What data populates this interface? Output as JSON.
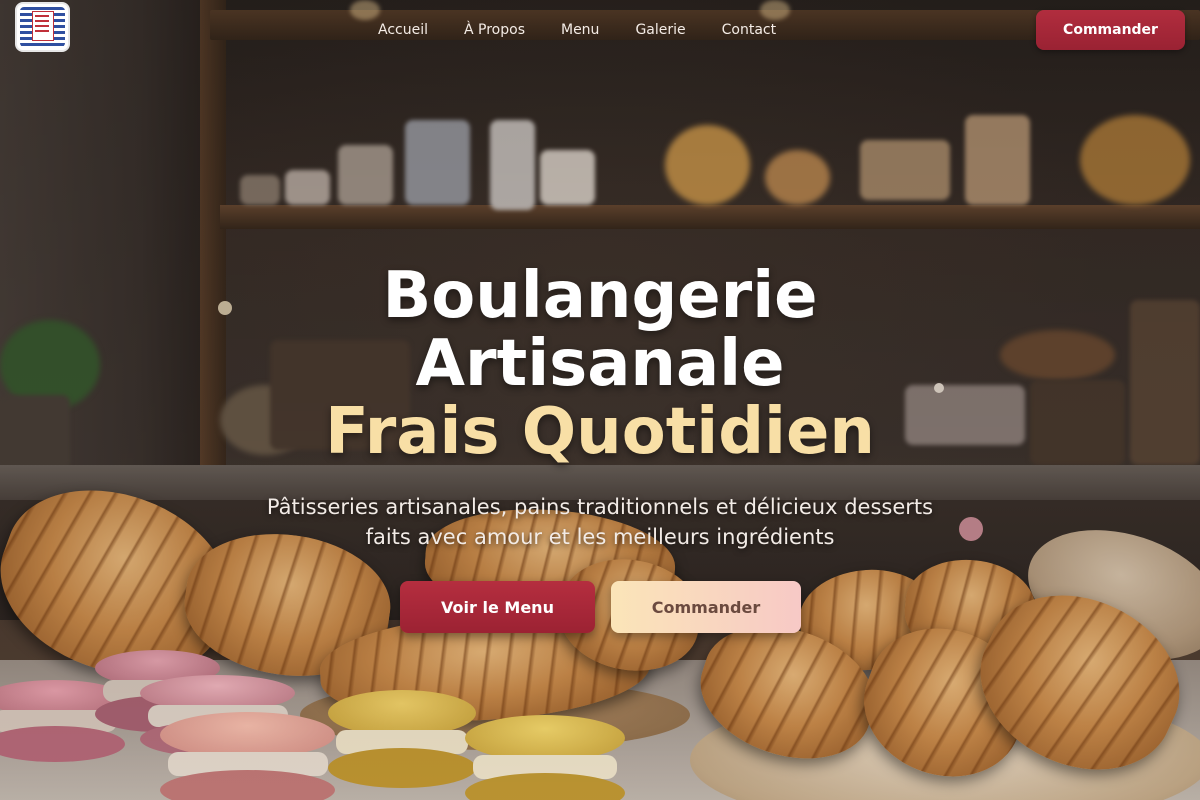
{
  "brand": {
    "logo_icon": "bakery-logo-icon"
  },
  "nav": {
    "items": [
      {
        "label": "Accueil"
      },
      {
        "label": "À Propos"
      },
      {
        "label": "Menu"
      },
      {
        "label": "Galerie"
      },
      {
        "label": "Contact"
      }
    ],
    "order_button": "Commander"
  },
  "hero": {
    "title_line1": "Boulangerie",
    "title_line2": "Artisanale",
    "title_accent": "Frais Quotidien",
    "subtitle": "Pâtisseries artisanales, pains traditionnels et délicieux desserts faits avec amour et les meilleurs ingrédients",
    "primary_button": "Voir le Menu",
    "secondary_button": "Commander"
  },
  "colors": {
    "primary": "#a8283a",
    "accent_text": "#f8dfa6",
    "secondary_button_from": "#fbe5b8",
    "secondary_button_to": "#f7c9c6"
  }
}
